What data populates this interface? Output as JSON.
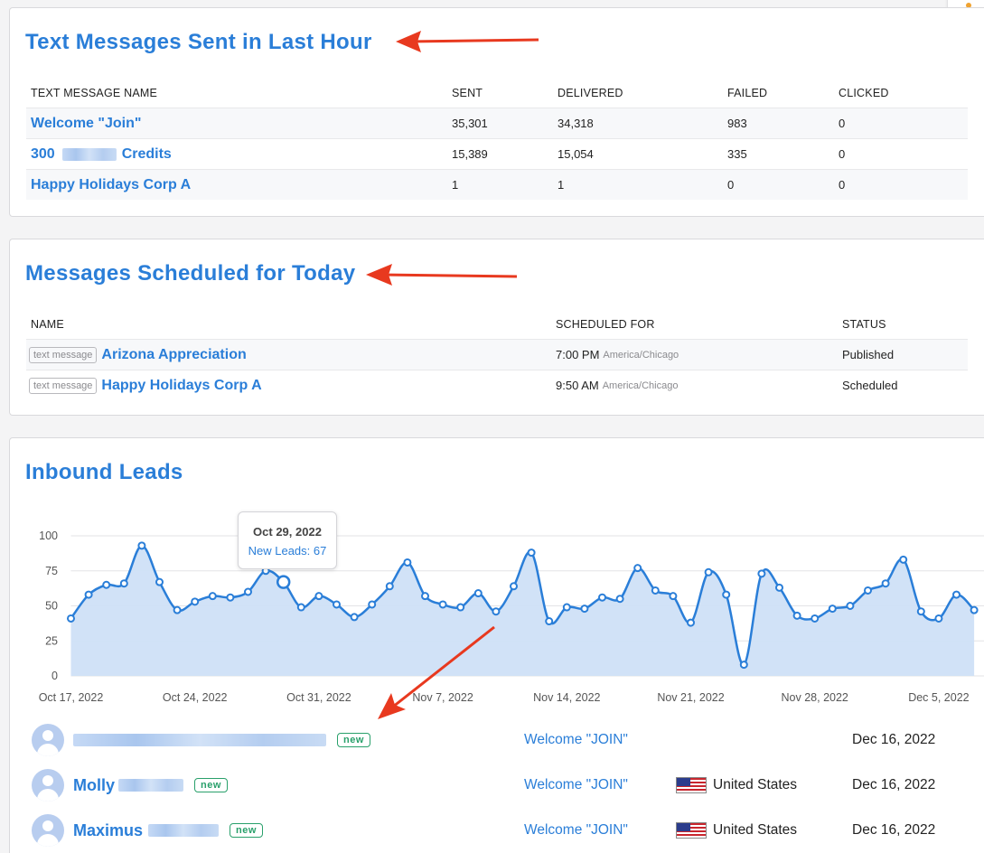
{
  "sent_card": {
    "title": "Text Messages Sent in Last Hour",
    "headers": [
      "TEXT MESSAGE NAME",
      "SENT",
      "DELIVERED",
      "FAILED",
      "CLICKED"
    ],
    "rows": [
      {
        "name_a": "Welcome \"Join\"",
        "name_b": "",
        "sent": "35,301",
        "delivered": "34,318",
        "failed": "983",
        "clicked": "0"
      },
      {
        "name_a": "300",
        "name_b": "Credits",
        "sent": "15,389",
        "delivered": "15,054",
        "failed": "335",
        "clicked": "0"
      },
      {
        "name_a": "Happy Holidays Corp A",
        "name_b": "",
        "sent": "1",
        "delivered": "1",
        "failed": "0",
        "clicked": "0"
      }
    ]
  },
  "sched_card": {
    "title": "Messages Scheduled for Today",
    "headers": [
      "NAME",
      "SCHEDULED FOR",
      "STATUS"
    ],
    "rows": [
      {
        "tag": "text message",
        "name": "Arizona Appreciation",
        "time": "7:00 PM",
        "tz": "America/Chicago",
        "status": "Published"
      },
      {
        "tag": "text message",
        "name": "Happy Holidays Corp A",
        "time": "9:50 AM",
        "tz": "America/Chicago",
        "status": "Scheduled"
      }
    ]
  },
  "leads_card": {
    "title": "Inbound Leads",
    "tooltip": {
      "date": "Oct 29, 2022",
      "label": "New Leads: 67"
    },
    "leads": [
      {
        "first": "",
        "badge": "new",
        "campaign": "Welcome \"JOIN\"",
        "country": "",
        "date": "Dec 16, 2022"
      },
      {
        "first": "Molly",
        "badge": "new",
        "campaign": "Welcome \"JOIN\"",
        "country": "United States",
        "date": "Dec 16, 2022"
      },
      {
        "first": "Maximus",
        "badge": "new",
        "campaign": "Welcome \"JOIN\"",
        "country": "United States",
        "date": "Dec 16, 2022"
      }
    ]
  },
  "colors": {
    "accent": "#2a7ed8",
    "line": "#2a7ed8",
    "fill": "#cfe0f7",
    "badge": "#29a06b",
    "arrow": "#e8391f"
  },
  "icons": {
    "avatar": "person-avatar-icon",
    "flag": "us-flag-icon",
    "arrow": "red-arrow-annotation"
  },
  "chart_data": {
    "type": "area",
    "x": [
      "Oct 17, 2022",
      "Oct 18, 2022",
      "Oct 19, 2022",
      "Oct 20, 2022",
      "Oct 21, 2022",
      "Oct 22, 2022",
      "Oct 23, 2022",
      "Oct 24, 2022",
      "Oct 25, 2022",
      "Oct 26, 2022",
      "Oct 27, 2022",
      "Oct 28, 2022",
      "Oct 29, 2022",
      "Oct 30, 2022",
      "Oct 31, 2022",
      "Nov 1, 2022",
      "Nov 2, 2022",
      "Nov 3, 2022",
      "Nov 4, 2022",
      "Nov 5, 2022",
      "Nov 6, 2022",
      "Nov 7, 2022",
      "Nov 8, 2022",
      "Nov 9, 2022",
      "Nov 10, 2022",
      "Nov 11, 2022",
      "Nov 12, 2022",
      "Nov 13, 2022",
      "Nov 14, 2022",
      "Nov 15, 2022",
      "Nov 16, 2022",
      "Nov 17, 2022",
      "Nov 18, 2022",
      "Nov 19, 2022",
      "Nov 20, 2022",
      "Nov 21, 2022",
      "Nov 22, 2022",
      "Nov 23, 2022",
      "Nov 24, 2022",
      "Nov 25, 2022",
      "Nov 26, 2022",
      "Nov 27, 2022",
      "Nov 28, 2022",
      "Nov 29, 2022",
      "Nov 30, 2022",
      "Dec 1, 2022",
      "Dec 2, 2022",
      "Dec 3, 2022",
      "Dec 4, 2022",
      "Dec 5, 2022",
      "Dec 6, 2022",
      "Dec 7, 2022"
    ],
    "series": [
      {
        "values": [
          41,
          58,
          65,
          66,
          93,
          67,
          47,
          53,
          57,
          56,
          60,
          75,
          67,
          49,
          57,
          51,
          42,
          51,
          64,
          81,
          57,
          51,
          49,
          59,
          46,
          64,
          88,
          39,
          49,
          48,
          56,
          55,
          77,
          61,
          57,
          38,
          74,
          58,
          8,
          73,
          63,
          43,
          41,
          48,
          50,
          61,
          66,
          83,
          46,
          41,
          58,
          47
        ]
      }
    ],
    "xticks": [
      "Oct 17, 2022",
      "Oct 24, 2022",
      "Oct 31, 2022",
      "Nov 7, 2022",
      "Nov 14, 2022",
      "Nov 21, 2022",
      "Nov 28, 2022",
      "Dec 5, 2022"
    ],
    "yticks": [
      0,
      25,
      50,
      75,
      100
    ],
    "ylim": [
      0,
      100
    ],
    "grid": true,
    "legend": "none"
  }
}
